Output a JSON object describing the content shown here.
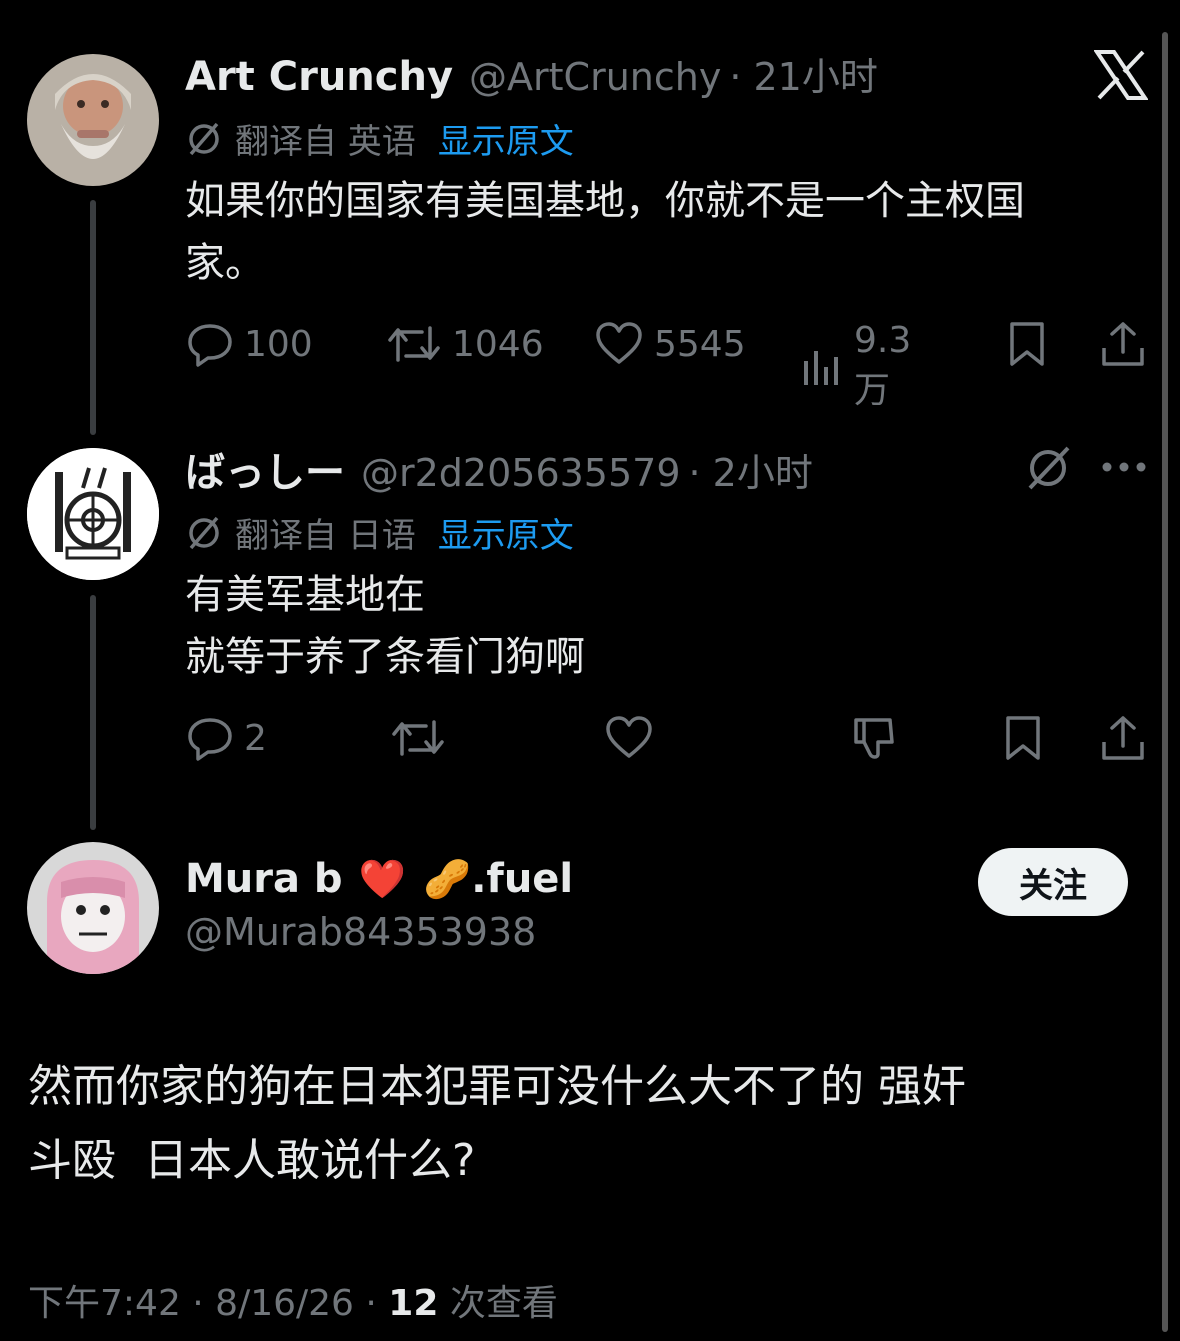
{
  "app": {
    "logo": "X"
  },
  "tweet1": {
    "name": "Art Crunchy",
    "handle": "@ArtCrunchy",
    "time": "· 21小时",
    "translated_from": "翻译自 英语",
    "show_original": "显示原文",
    "text_line1": "如果你的国家有美国基地，你就不是一个主权国",
    "text_line2": "家。",
    "replies": "100",
    "retweets": "1046",
    "likes": "5545",
    "views": "9.3万"
  },
  "tweet2": {
    "name": "ばっしー",
    "handle": "@r2d205635579",
    "time": "· 2小时",
    "translated_from": "翻译自 日语",
    "show_original": "显示原文",
    "text_line1": "有美军基地在",
    "text_line2": "就等于养了条看门狗啊",
    "replies": "2"
  },
  "tweet3": {
    "name": "Mura b",
    "name_emoji_heart": "❤️",
    "name_emoji_peanut": "🥜",
    "name_suffix": ".fuel",
    "handle": "@Murab84353938",
    "follow_label": "关注",
    "text_line1": "然而你家的狗在日本犯罪可没什么大不了的 强奸",
    "text_line2": "斗殴  日本人敢说什么?",
    "meta_time": "下午7:42 · 8/16/26 · ",
    "meta_views_count": "12",
    "meta_views_label": " 次查看"
  },
  "colors": {
    "background": "#000000",
    "text": "#e7e9ea",
    "muted": "#71767b",
    "link": "#1d9bf0",
    "follow_bg": "#eff3f4"
  }
}
